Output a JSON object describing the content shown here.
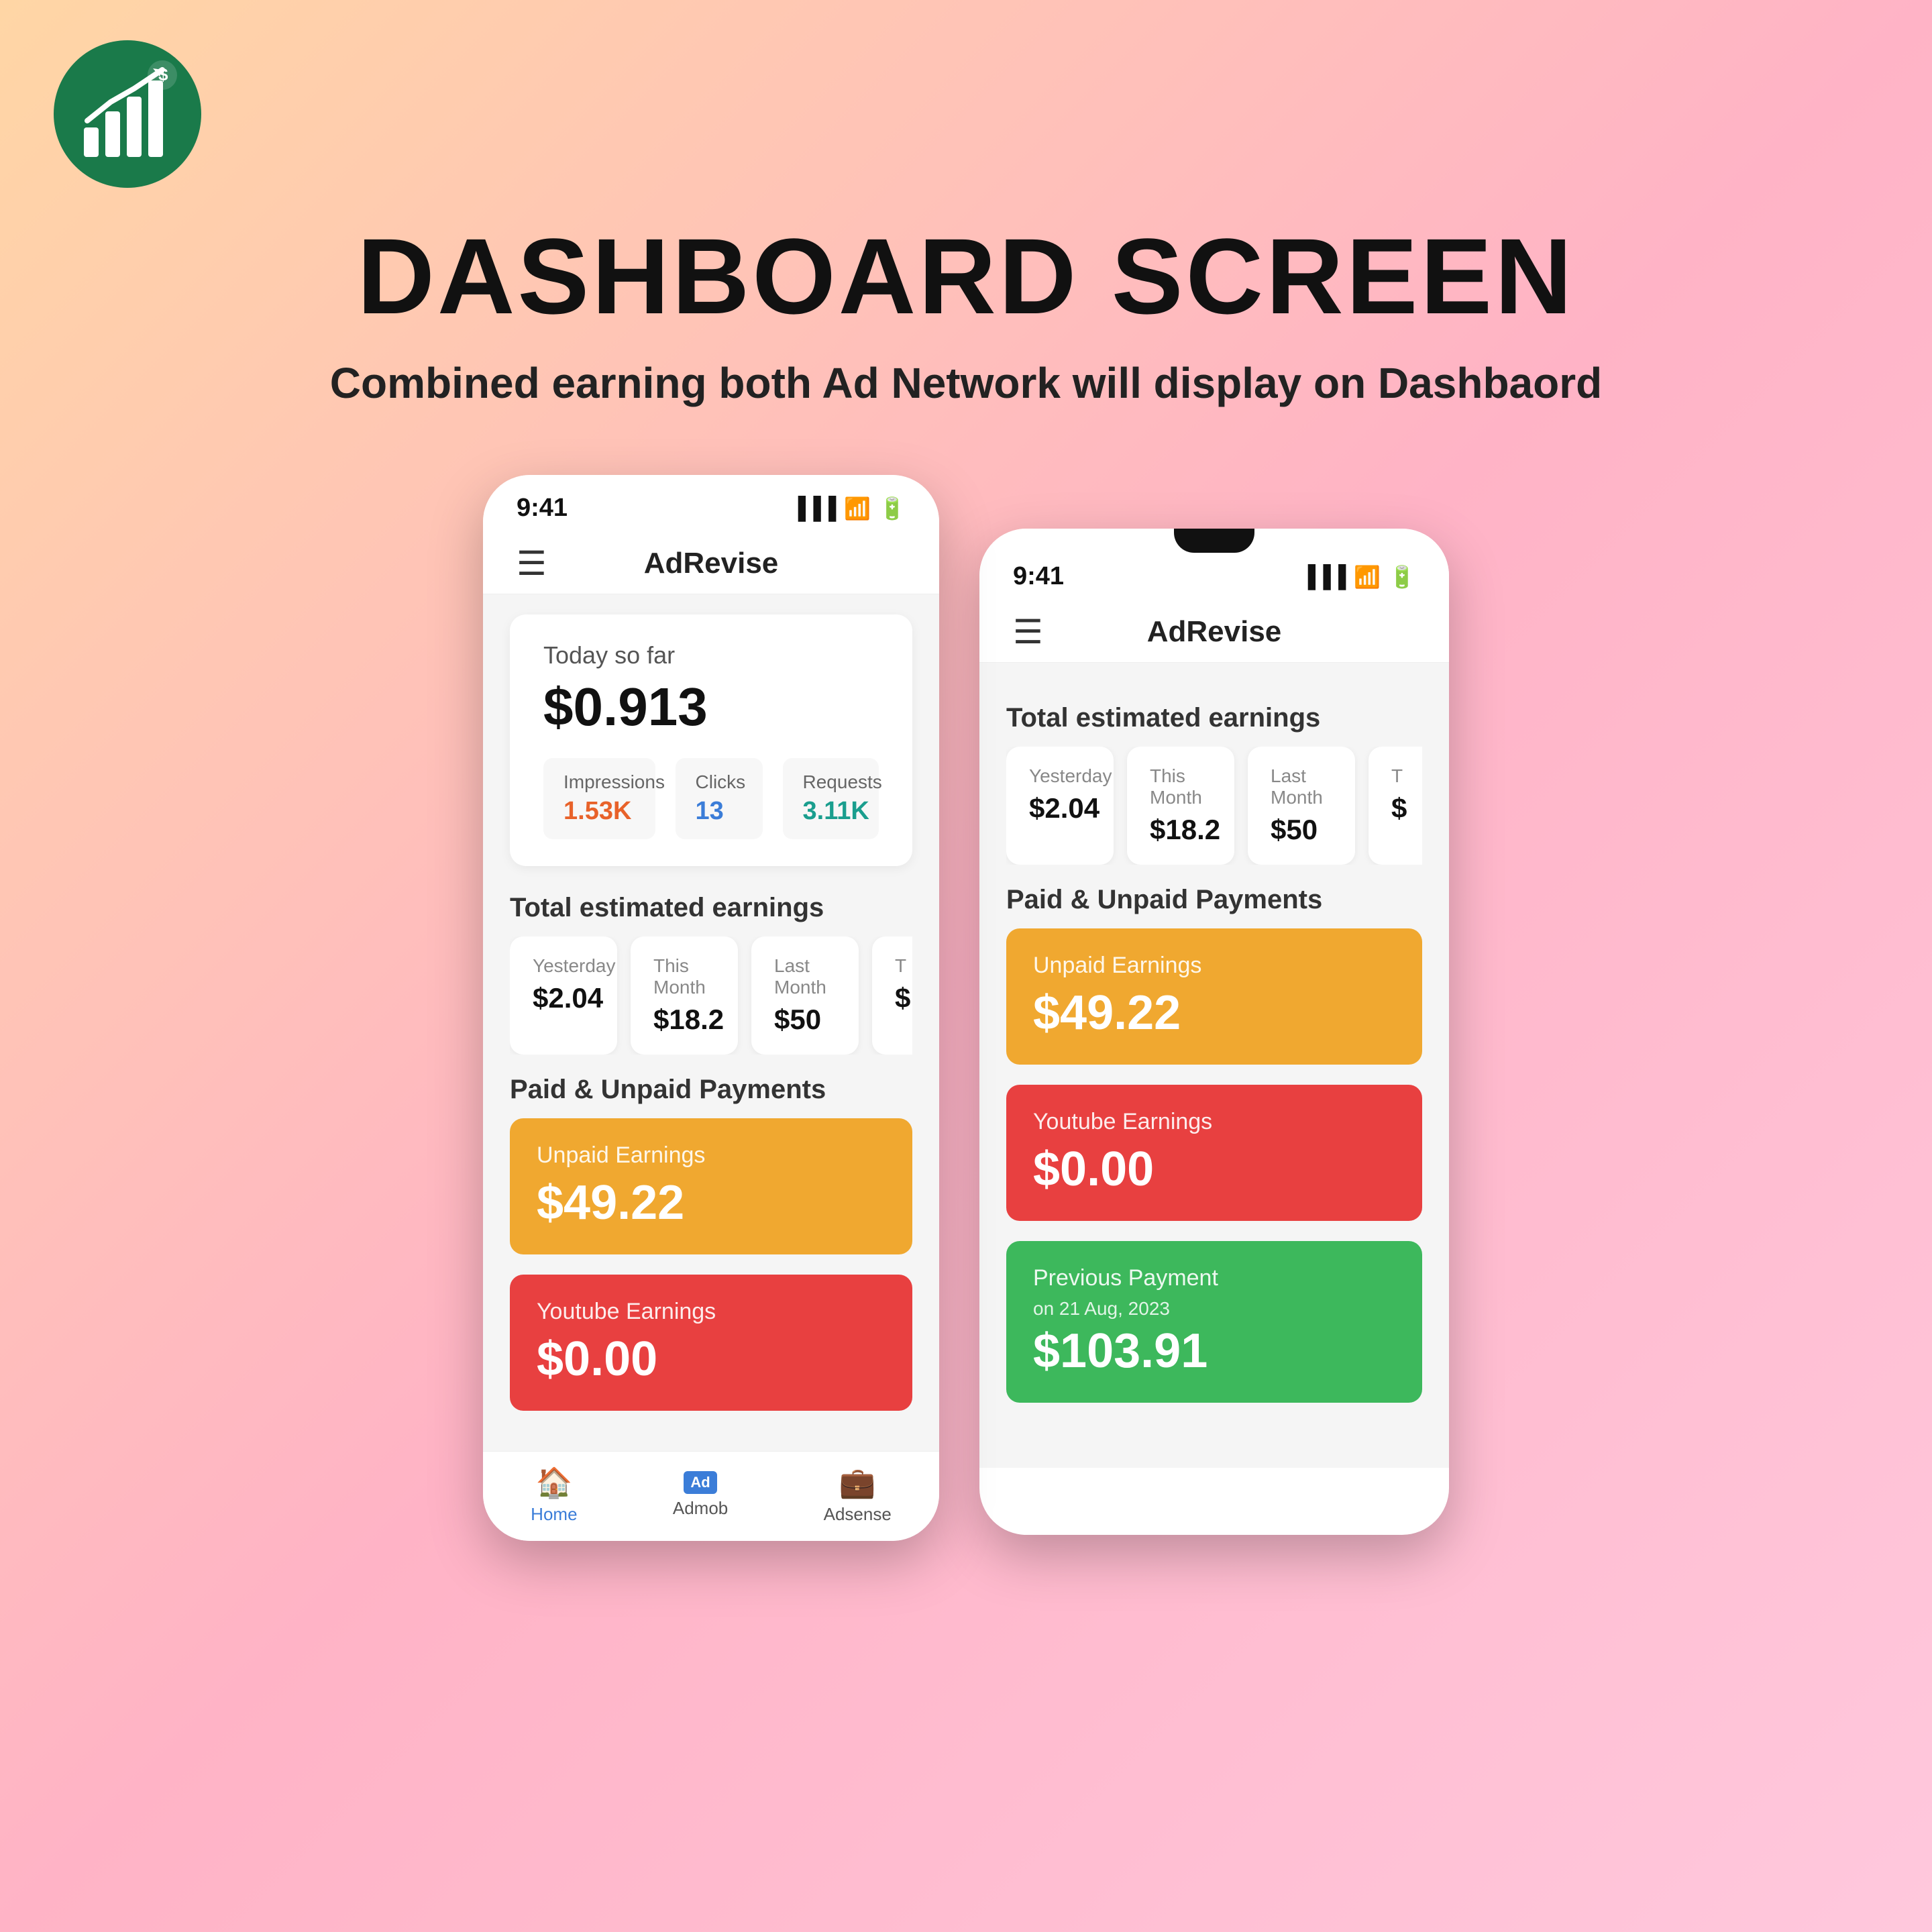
{
  "page": {
    "title": "DASHBOARD SCREEN",
    "subtitle": "Combined earning both Ad Network will display on Dashbaord"
  },
  "logo": {
    "bg_color": "#1a7a4a",
    "icon": "📈"
  },
  "phone1": {
    "status_time": "9:41",
    "app_title": "AdRevise",
    "today_label": "Today so far",
    "today_amount": "$0.913",
    "stats": [
      {
        "label": "Impressions",
        "value": "1.53K",
        "color": "orange"
      },
      {
        "label": "Clicks",
        "value": "13",
        "color": "blue"
      },
      {
        "label": "Requests",
        "value": "3.11K",
        "color": "teal"
      }
    ],
    "total_earnings_label": "Total estimated earnings",
    "earnings_cards": [
      {
        "label": "Yesterday",
        "value": "$2.04"
      },
      {
        "label": "This Month",
        "value": "$18.2"
      },
      {
        "label": "Last Month",
        "value": "$50"
      },
      {
        "label": "T...",
        "value": "$"
      }
    ],
    "payments_label": "Paid & Unpaid Payments",
    "unpaid_card": {
      "label": "Unpaid Earnings",
      "value": "$49.22",
      "color": "orange"
    },
    "youtube_card": {
      "label": "Youtube Earnings",
      "value": "$0.00",
      "color": "red"
    },
    "nav": [
      {
        "label": "Home",
        "icon": "🏠",
        "active": true
      },
      {
        "label": "Admob",
        "icon": "Ad",
        "active": false
      },
      {
        "label": "Adsense",
        "icon": "💼",
        "active": false
      }
    ]
  },
  "phone2": {
    "status_time": "9:41",
    "app_title": "AdRevise",
    "total_earnings_label": "Total estimated earnings",
    "earnings_cards": [
      {
        "label": "Yesterday",
        "value": "$2.04"
      },
      {
        "label": "This Month",
        "value": "$18.2"
      },
      {
        "label": "Last Month",
        "value": "$50"
      },
      {
        "label": "T...",
        "value": "$"
      }
    ],
    "payments_label": "Paid & Unpaid Payments",
    "unpaid_card": {
      "label": "Unpaid Earnings",
      "value": "$49.22",
      "color": "orange"
    },
    "youtube_card": {
      "label": "Youtube Earnings",
      "value": "$0.00",
      "color": "red"
    },
    "previous_card": {
      "label": "Previous Payment",
      "sublabel": "on 21 Aug, 2023",
      "value": "$103.91",
      "color": "green"
    }
  }
}
